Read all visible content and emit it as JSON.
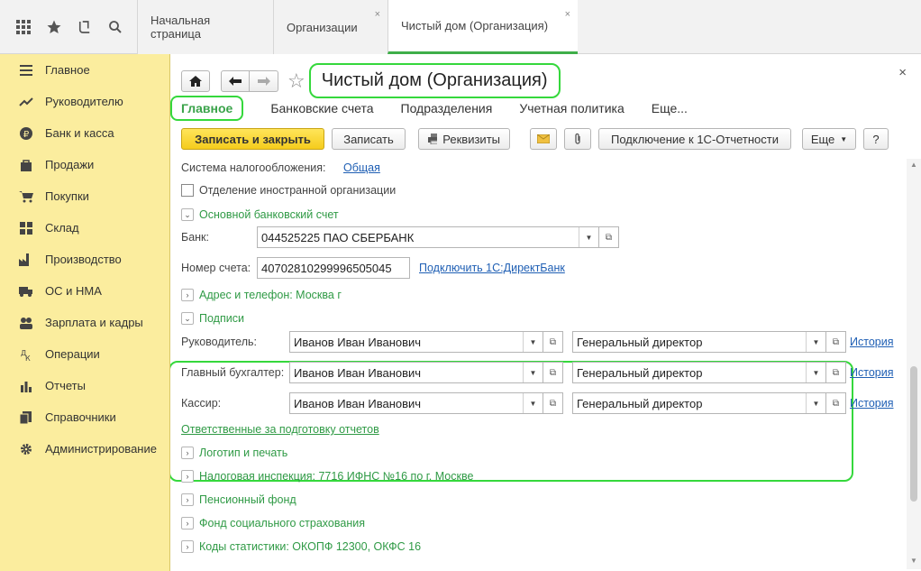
{
  "tabs": [
    {
      "label": "Начальная страница"
    },
    {
      "label": "Организации",
      "close": "×"
    },
    {
      "label": "Чистый дом (Организация)",
      "close": "×"
    }
  ],
  "sidebar": {
    "items": [
      {
        "label": "Главное",
        "icon": "menu-icon"
      },
      {
        "label": "Руководителю",
        "icon": "trend-icon"
      },
      {
        "label": "Банк и касса",
        "icon": "ruble-icon"
      },
      {
        "label": "Продажи",
        "icon": "bag-icon"
      },
      {
        "label": "Покупки",
        "icon": "cart-icon"
      },
      {
        "label": "Склад",
        "icon": "warehouse-icon"
      },
      {
        "label": "Производство",
        "icon": "factory-icon"
      },
      {
        "label": "ОС и НМА",
        "icon": "truck-icon"
      },
      {
        "label": "Зарплата и кадры",
        "icon": "people-icon"
      },
      {
        "label": "Операции",
        "icon": "operations-icon"
      },
      {
        "label": "Отчеты",
        "icon": "report-icon"
      },
      {
        "label": "Справочники",
        "icon": "book-icon"
      },
      {
        "label": "Администрирование",
        "icon": "gear-icon"
      }
    ]
  },
  "header": {
    "title": "Чистый дом (Организация)",
    "close": "×"
  },
  "form_tabs": [
    "Главное",
    "Банковские счета",
    "Подразделения",
    "Учетная политика",
    "Еще..."
  ],
  "toolbar": {
    "save_close": "Записать и закрыть",
    "save": "Записать",
    "details": "Реквизиты",
    "connect": "Подключение к 1С-Отчетности",
    "more": "Еще",
    "help": "?"
  },
  "form": {
    "tax_label": "Система налогообложения:",
    "tax_value": "Общая",
    "foreign": "Отделение иностранной организации",
    "bank_section": "Основной банковский счет",
    "bank_label": "Банк:",
    "bank_value": "044525225 ПАО СБЕРБАНК",
    "account_label": "Номер счета:",
    "account_value": "40702810299996505045",
    "directbank": "Подключить 1С:ДиректБанк",
    "address": "Адрес и телефон: Москва г",
    "signatures": "Подписи",
    "signers": [
      {
        "role": "Руководитель:",
        "person": "Иванов Иван Иванович",
        "position": "Генеральный директор",
        "history": "История"
      },
      {
        "role": "Главный бухгалтер:",
        "person": "Иванов Иван Иванович",
        "position": "Генеральный директор",
        "history": "История"
      },
      {
        "role": "Кассир:",
        "person": "Иванов Иван Иванович",
        "position": "Генеральный директор",
        "history": "История"
      }
    ],
    "responsible": "Ответственные за подготовку отчетов",
    "sections": [
      "Логотип и печать",
      "Налоговая инспекция: 7716 ИФНС №16 по г. Москве",
      "Пенсионный фонд",
      "Фонд социального страхования",
      "Коды статистики: ОКОПФ 12300, ОКФС 16"
    ]
  },
  "colors": {
    "accent_green": "#3aa34a",
    "sidebar_bg": "#fbed9e",
    "primary_yellow": "#f5cc1c",
    "link_blue": "#1f5fb4"
  }
}
